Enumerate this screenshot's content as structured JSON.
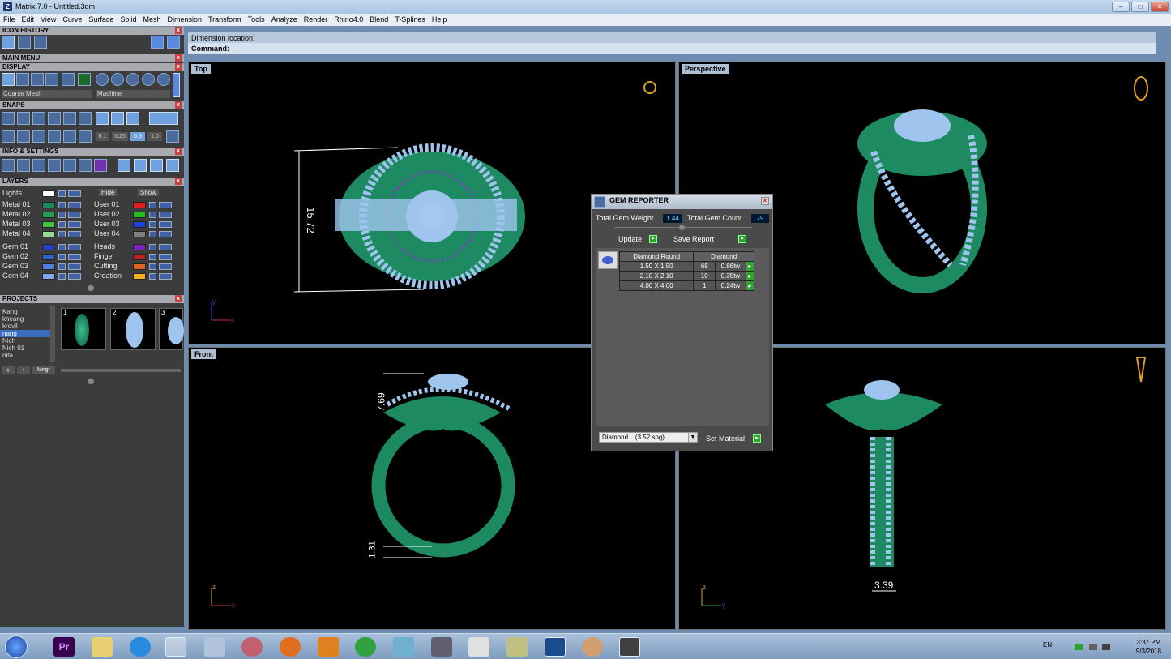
{
  "window": {
    "title": "Matrix 7.0 - Untitled.3dm",
    "minimize": "–",
    "maximize": "□",
    "close": "✕"
  },
  "menu": [
    "File",
    "Edit",
    "View",
    "Curve",
    "Surface",
    "Solid",
    "Mesh",
    "Dimension",
    "Transform",
    "Tools",
    "Analyze",
    "Render",
    "Rhino4.0",
    "Blend",
    "T-Splines",
    "Help"
  ],
  "panels": {
    "icon_history": "ICON HISTORY",
    "main_menu": "MAIN MENU",
    "display": "DISPLAY",
    "display_mesh": "Coarse Mesh",
    "display_mode": "Machine",
    "snaps": "SNAPS",
    "snap_values": [
      "0.1",
      "0.25",
      "0.5",
      "1.0"
    ],
    "info_settings": "INFO & SETTINGS",
    "layers": "LAYERS",
    "projects": "PROJECTS",
    "close_glyph": "x"
  },
  "layers": {
    "lights": "Lights",
    "hide": "Hide",
    "show": "Show",
    "left": [
      {
        "name": "Metal 01",
        "color": "#1a8a5a"
      },
      {
        "name": "Metal 02",
        "color": "#20a050"
      },
      {
        "name": "Metal 03",
        "color": "#40c040"
      },
      {
        "name": "Metal 04",
        "color": "#90e090"
      },
      {
        "name": "Gem 01",
        "color": "#2040c0"
      },
      {
        "name": "Gem 02",
        "color": "#3060d0"
      },
      {
        "name": "Gem 03",
        "color": "#5080e0"
      },
      {
        "name": "Gem 04",
        "color": "#80a8f0"
      }
    ],
    "right": [
      {
        "name": "User 01",
        "color": "#e02020"
      },
      {
        "name": "User 02",
        "color": "#20c020"
      },
      {
        "name": "User 03",
        "color": "#2040e0"
      },
      {
        "name": "User 04",
        "color": "#808080"
      },
      {
        "name": "Heads",
        "color": "#8020c0"
      },
      {
        "name": "Finger",
        "color": "#c02020"
      },
      {
        "name": "Cutting",
        "color": "#e06020"
      },
      {
        "name": "Creation",
        "color": "#f0b020"
      }
    ]
  },
  "projects": {
    "names": [
      "Kang",
      "kheang",
      "krovil",
      "nang",
      "Nich",
      "Nich 01",
      "nita"
    ],
    "selected": "nang",
    "thumbs": [
      "1",
      "2",
      "3"
    ],
    "buttons": [
      "+",
      "↑",
      "Mngr"
    ]
  },
  "command": {
    "prompt": "Dimension location:",
    "label": "Command:"
  },
  "viewports": {
    "top": {
      "label": "Top",
      "dimension": "15.72",
      "axis_x": "x",
      "axis_y": "y"
    },
    "perspective": {
      "label": "Perspective"
    },
    "front": {
      "label": "Front",
      "dimension_top": "7.69",
      "dimension_bottom": "1.31",
      "axis_x": "x",
      "axis_y": "z"
    },
    "right": {
      "label": "",
      "dimension": "3.39",
      "axis_x": "y",
      "axis_y": "z"
    }
  },
  "gem_reporter": {
    "title": "GEM REPORTER",
    "weight_label": "Total Gem Weight",
    "weight": "1.44",
    "count_label": "Total Gem Count",
    "count": "79",
    "update": "Update",
    "save": "Save Report",
    "table_headers": [
      "Diamond Round",
      "Diamond"
    ],
    "rows": [
      {
        "size": "1.50 X 1.50",
        "count": "68",
        "weight": "0.86tw"
      },
      {
        "size": "2.10 X 2.10",
        "count": "10",
        "weight": "0.35tw"
      },
      {
        "size": "4.00 X 4.00",
        "count": "1",
        "weight": "0.24tw"
      }
    ],
    "material": "Diamond    (3.52 spg)",
    "set_material": "Set Material"
  },
  "taskbar": {
    "lang": "EN",
    "time": "3:37 PM",
    "date": "9/3/2018",
    "premiere": "Pr"
  },
  "colors": {
    "metal": "#1d8a62",
    "gem": "#9fc4ee",
    "prong": "#8a2fd0",
    "accent": "#aebfd3"
  }
}
